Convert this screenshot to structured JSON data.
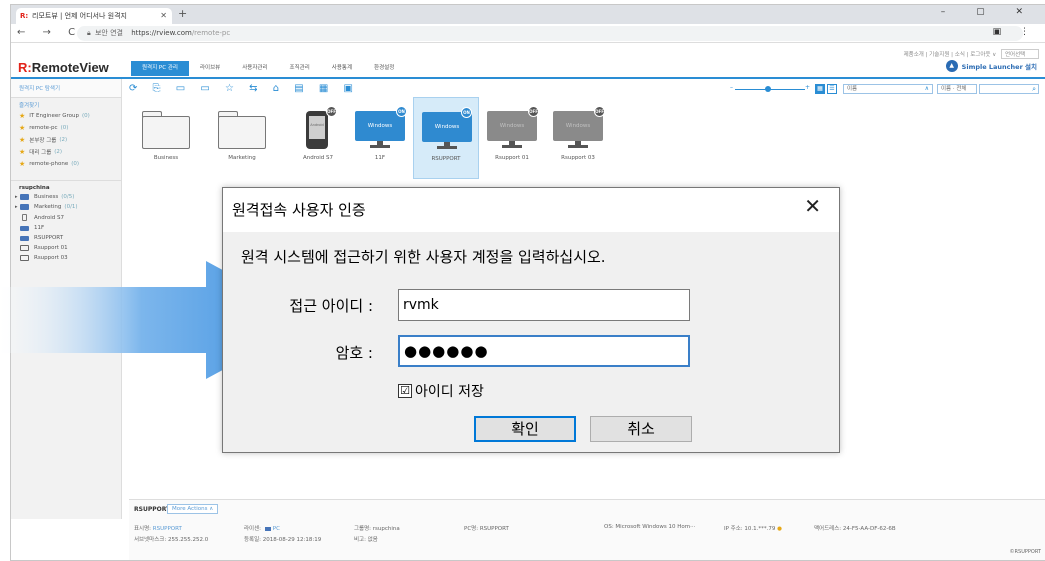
{
  "browser": {
    "tab_title": "리모트뷰 | 언제 어디서나 원격지",
    "tab_favicon": "R:",
    "new_tab": "+",
    "window_controls": "– ▢ ✕",
    "nav_icons": "← → C",
    "security_label": "보안 연결",
    "url_host": "https://rview.com",
    "url_path": "/remote-pc",
    "addr_icons": "▣ ⋮"
  },
  "header": {
    "top_links": "제품소개 | 기술지원 | 소식 | 로그아웃 ∨",
    "language_select": "언어선택",
    "logo_mark": "R:",
    "logo_text": "RemoteView",
    "menu": [
      "원격지 PC 관리",
      "라이브뷰",
      "사용자관리",
      "조직관리",
      "사용통계",
      "환경설정"
    ],
    "launcher_label": "Simple Launcher 설치",
    "accent_color": "#2a8dd4"
  },
  "sidebar": {
    "search_label": "원격지 PC 탐색기",
    "favorites_label": "즐겨찾기",
    "favorites": [
      {
        "name": "IT Engineer Group",
        "count": "(0)"
      },
      {
        "name": "remote-pc",
        "count": "(0)"
      },
      {
        "name": "본부장 그룹",
        "count": "(2)"
      },
      {
        "name": "대리 그룹",
        "count": "(2)"
      },
      {
        "name": "remote-phone",
        "count": "(0)"
      }
    ],
    "user_label": "rsupchina",
    "tree": [
      {
        "name": "Business",
        "count": "(0/5)"
      },
      {
        "name": "Marketing",
        "count": "(0/1)"
      },
      {
        "name": "Android S7",
        "count": ""
      },
      {
        "name": "11F",
        "count": ""
      },
      {
        "name": "RSUPPORT",
        "count": ""
      },
      {
        "name": "Rsupport 01",
        "count": ""
      },
      {
        "name": "Rsupport 03",
        "count": ""
      }
    ]
  },
  "toolbar": {
    "icons": "⟳ ⎘ ▭ ▭ ☆ ⇆ ⌂ ▤ ▦ ▣",
    "slider_min": "–",
    "slider_max": "+",
    "sort_select": "이름",
    "filter_select": "이름 · 전체",
    "search_icon": "⌕"
  },
  "devices": [
    {
      "label": "Business",
      "kind": "folder"
    },
    {
      "label": "Marketing",
      "kind": "folder"
    },
    {
      "label": "Android S7",
      "kind": "android",
      "badge": "OFF",
      "screen": "Android"
    },
    {
      "label": "11F",
      "kind": "windows",
      "badge": "ON",
      "screen": "Windows"
    },
    {
      "label": "RSUPPORT",
      "kind": "windows",
      "badge": "ON",
      "screen": "Windows"
    },
    {
      "label": "Rsupport 01",
      "kind": "windows-off",
      "badge": "OFF",
      "screen": "Windows"
    },
    {
      "label": "Rsupport 03",
      "kind": "windows-off",
      "badge": "OFF",
      "screen": "Windows"
    }
  ],
  "info_panel": {
    "device_name": "RSUPPORT",
    "more_actions": "More Actions ∧",
    "display_name_label": "표시명:",
    "display_name": "RSUPPORT",
    "type_label": "라이센:",
    "type_value": "PC",
    "group_label": "그룹명: rsupchina",
    "pc_label": "PC명: RSUPPORT",
    "os_label": "OS: Microsoft Windows 10 Hom···",
    "ip_label": "IP 주소: 10.1.***.79",
    "mac_label": "맥어드레스: 24-F5-AA-DF-62-6B",
    "subnet_label": "서브넷마스크: 255.255.252.0",
    "registered_label": "등록일: 2018-08-29 12:18:19",
    "note_label": "비고: 없음",
    "copyright": "©RSUPPORT"
  },
  "dialog": {
    "title": "원격접속 사용자 인증",
    "close_icon": "✕",
    "message": "원격 시스템에 접근하기 위한 사용자 계정을 입력하십시오.",
    "id_label": "접근 아이디 :",
    "id_value": "rvmk",
    "pw_label": "암호 :",
    "pw_value": "●●●●●●",
    "save_checkbox_mark": "☑",
    "save_label": "아이디 저장",
    "ok_label": "확인",
    "cancel_label": "취소"
  },
  "overlay": {
    "arrow_color": "#5b9fe0"
  }
}
